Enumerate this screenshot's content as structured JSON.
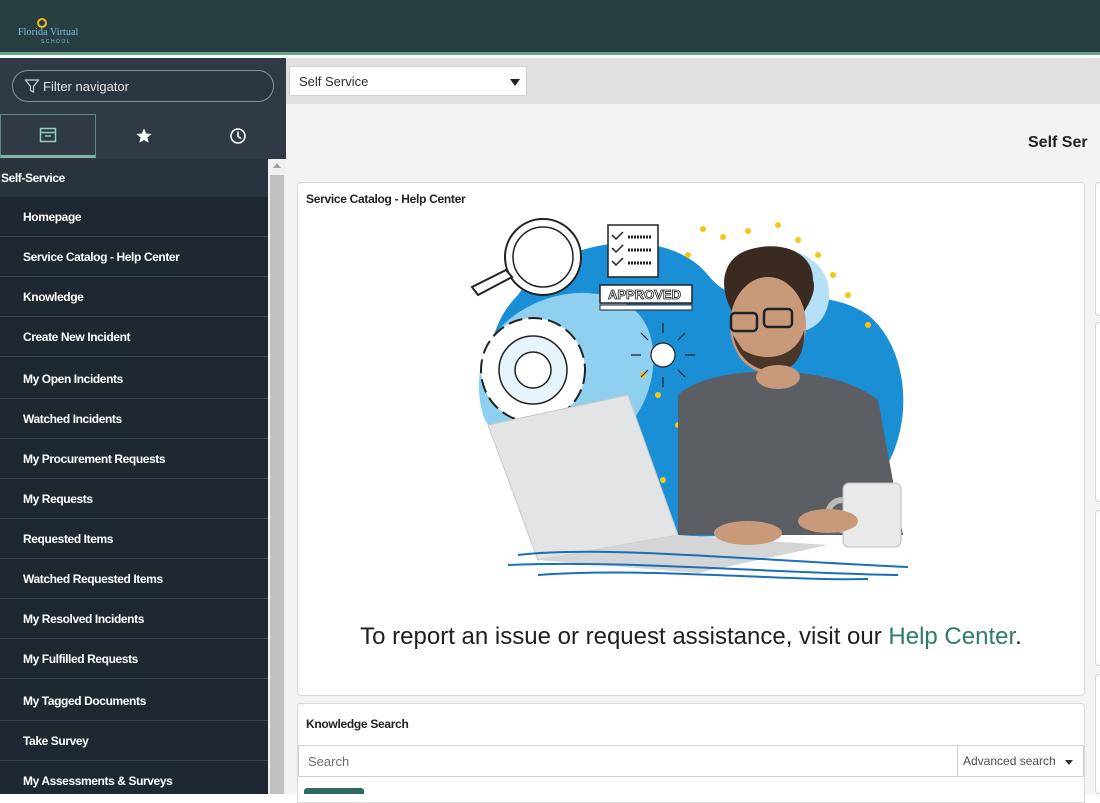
{
  "header": {
    "logo_name": "Florida Virtual",
    "logo_sub": "SCHOOL",
    "bg_color": "#293e40",
    "accent_color": "#62a88a"
  },
  "navigator": {
    "filter_placeholder": "Filter navigator",
    "tabs": [
      {
        "icon": "archive-icon",
        "active": true
      },
      {
        "icon": "star-icon",
        "active": false
      },
      {
        "icon": "clock-icon",
        "active": false
      }
    ],
    "section_title": "Self-Service",
    "items": [
      {
        "label": "Homepage"
      },
      {
        "label": "Service Catalog - Help Center"
      },
      {
        "label": "Knowledge"
      },
      {
        "label": "Create New Incident"
      },
      {
        "label": "My Open Incidents"
      },
      {
        "label": "Watched Incidents"
      },
      {
        "label": "My Procurement Requests"
      },
      {
        "label": "My Requests"
      },
      {
        "label": "Requested Items"
      },
      {
        "label": "Watched Requested Items"
      },
      {
        "label": "My Resolved Incidents"
      },
      {
        "label": "My Fulfilled Requests"
      },
      {
        "label": "My Tagged Documents"
      },
      {
        "label": "Take Survey"
      },
      {
        "label": "My Assessments & Surveys"
      }
    ]
  },
  "toolbar": {
    "selector_value": "Self Service"
  },
  "main": {
    "page_title": "Self Ser",
    "catalog_card": {
      "title": "Service Catalog - Help Center",
      "stamp_text": "APPROVED",
      "cta_text": "To report an issue or request assistance, visit our ",
      "cta_link": "Help Center",
      "cta_end": ".",
      "link_color": "#2f7c6c"
    },
    "knowledge_card": {
      "title": "Knowledge Search",
      "search_placeholder": "Search",
      "advanced_label": "Advanced search"
    }
  }
}
